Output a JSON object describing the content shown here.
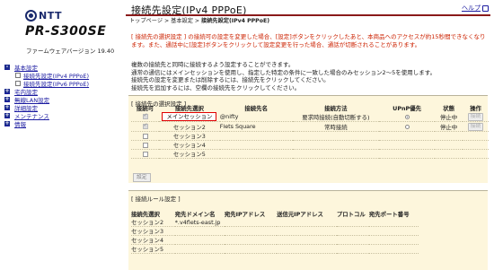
{
  "sidebar": {
    "brand": "NTT",
    "model": "PR-S300SE",
    "firmware": "ファームウェアバージョン 19.40",
    "items": [
      {
        "label": "基本設定",
        "expand": "-"
      },
      {
        "label": "接続先設定(IPv4 PPPoE)",
        "sub": true
      },
      {
        "label": "接続先設定(IPv6 PPPoE)",
        "sub": true
      },
      {
        "label": "宅内設定",
        "expand": "+"
      },
      {
        "label": "無線LAN設定",
        "expand": "+"
      },
      {
        "label": "詳細設定",
        "expand": "+"
      },
      {
        "label": "メンテナンス",
        "expand": "+"
      },
      {
        "label": "情報",
        "expand": "+"
      }
    ]
  },
  "header": {
    "title": "接続先設定(IPv4 PPPoE)",
    "help": "ヘルプ",
    "breadcrumb": [
      "トップページ",
      "基本設定",
      "接続先設定(IPv4 PPPoE)"
    ],
    "crumb_sep": " > "
  },
  "warning": "[ 接続先の選択設定 ] の接続可の設定を変更した場合、[設定]ボタンをクリックしたあと、本商品へのアクセスが約15秒間できなくなります。また、通話中に[設定]ボタンをクリックして設定変更を行った場合、通話が切断されることがあります。",
  "description": [
    "複数の接続先と同時に接続するよう設定することができます。",
    "通常の通信にはメインセッションを使用し、指定した特定の条件に一致した場合のみセッション2〜5を使用します。",
    "接続先の設定を変更または削除するには、接続先をクリックしてください。",
    "接続先を追加するには、空欄の接続先をクリックしてください。"
  ],
  "select_panel": {
    "title": "[ 接続先の選択設定 ]",
    "headers": [
      "接続可",
      "接続先選択",
      "接続先名",
      "接続方法",
      "UPnP優先",
      "状態",
      "操作"
    ],
    "rows": [
      {
        "checked": true,
        "name": "メインセッション",
        "dest": "@nifty",
        "method": "要求時接続(自動切断する)",
        "upnp": true,
        "state": "停止中",
        "op": "接続"
      },
      {
        "checked": true,
        "name": "セッション2",
        "dest": "Flets Square",
        "method": "常時接続",
        "upnp": false,
        "state": "停止中",
        "op": "接続"
      },
      {
        "checked": false,
        "name": "セッション3",
        "dest": "",
        "method": "",
        "upnp": false,
        "state": "",
        "op": ""
      },
      {
        "checked": false,
        "name": "セッション4",
        "dest": "",
        "method": "",
        "upnp": false,
        "state": "",
        "op": ""
      },
      {
        "checked": false,
        "name": "セッション5",
        "dest": "",
        "method": "",
        "upnp": false,
        "state": "",
        "op": ""
      }
    ],
    "set_button": "設定"
  },
  "rule_panel": {
    "title": "[ 接続ルール設定 ]",
    "headers": [
      "接続先選択",
      "宛先ドメイン名",
      "宛先IPアドレス",
      "送信元IPアドレス",
      "プロトコル",
      "宛先ポート番号"
    ],
    "rows": [
      {
        "name": "セッション2",
        "domain": "*.v4flets-east.jp"
      },
      {
        "name": "セッション3",
        "domain": ""
      },
      {
        "name": "セッション4",
        "domain": ""
      },
      {
        "name": "セッション5",
        "domain": ""
      }
    ]
  }
}
